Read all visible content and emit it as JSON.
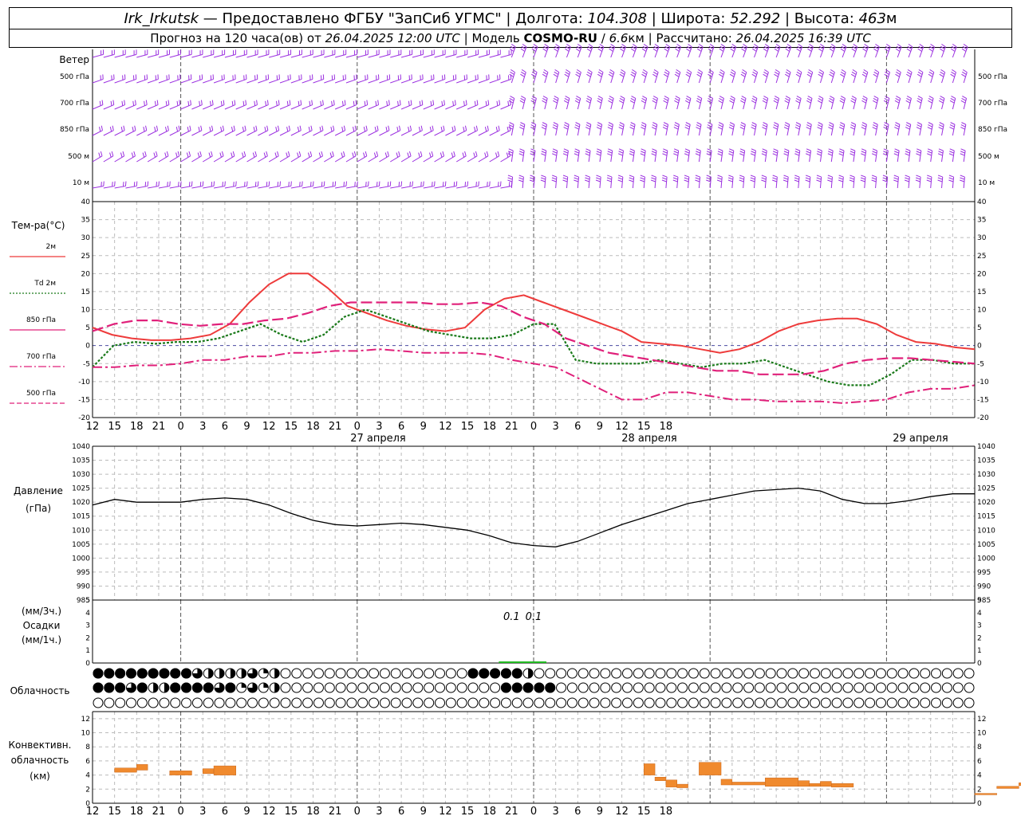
{
  "header": {
    "station": "Irk_Irkutsk",
    "dash": "—",
    "provider": "Предоставлено ФГБУ \"ЗапСиб УГМС\"",
    "lon_label": "Долгота:",
    "lon_value": "104.308",
    "lat_label": "Широта:",
    "lat_value": "52.292",
    "alt_label": "Высота:",
    "alt_value": "463",
    "alt_unit": "м",
    "forecast_prefix": "Прогноз на 120 часа(ов) от",
    "forecast_start": "26.04.2025 12:00 UTC",
    "model_label": "Модель",
    "model_name": "COSMO-RU",
    "model_res": "6.6",
    "model_res_unit": "км",
    "calc_label": "Рассчитано:",
    "calc_time": "26.04.2025 16:39 UTC"
  },
  "wind": {
    "title": "Ветер",
    "levels": [
      "500 гПа",
      "700 гПа",
      "850 гПа",
      "500 м",
      "10  м"
    ],
    "color": "#9b30e0"
  },
  "temperature": {
    "title": "Тем-ра(°C)",
    "legend": [
      {
        "label": "2м",
        "color": "#ee3b3b",
        "style": "solid"
      },
      {
        "label": "Td 2м",
        "color": "#1a7a1a",
        "style": "dotted"
      },
      {
        "label": "850 гПа",
        "color": "#e0207a",
        "style": "solid"
      },
      {
        "label": "700 гПа",
        "color": "#e0207a",
        "style": "dashdot"
      },
      {
        "label": "500 гПа",
        "color": "#e0207a",
        "style": "dash"
      }
    ],
    "yticks": [
      "40",
      "35",
      "30",
      "25",
      "20",
      "15",
      "10",
      "5",
      "0",
      "-5",
      "-10",
      "-15",
      "-20"
    ]
  },
  "x_axis": {
    "hour_labels": [
      "12",
      "15",
      "18",
      "21",
      "0",
      "3",
      "6",
      "9",
      "12",
      "15",
      "18",
      "21",
      "0",
      "3",
      "6",
      "9",
      "12",
      "15",
      "18",
      "21",
      "0",
      "3",
      "6",
      "9",
      "12",
      "15",
      "18"
    ],
    "date_labels": [
      "27 апреля",
      "28 апреля",
      "29 апреля"
    ]
  },
  "pressure": {
    "title_line1": "Давление",
    "title_line2": "(гПа)",
    "yticks": [
      "1040",
      "1035",
      "1030",
      "1025",
      "1020",
      "1015",
      "1010",
      "1005",
      "1000",
      "995",
      "990",
      "985"
    ]
  },
  "precip": {
    "unit_3h": "(мм/3ч.)",
    "title": "Осадки",
    "unit_1h": "(мм/1ч.)",
    "yticks": [
      "5",
      "4",
      "3",
      "2",
      "1",
      "0"
    ],
    "annotations": [
      "0.1",
      "0.1"
    ]
  },
  "cloud": {
    "title": "Облачность",
    "rows": [
      "4445444443222231200000000000000000444442000000000000000000000000000000000000000000000000000000000000000000000000000000000000000000000000",
      "4443422444434131200000000000000000000444440000000000000000000000000000000000000000000000000000000000000000000000000000000000000000000000",
      "0000000000000000000000000000000000000000000000000000000000000000000000000000000000000000000000000000000000000000000000000000000000000000"
    ]
  },
  "convective": {
    "title_line1": "Конвективн.",
    "title_line2": "облачность",
    "title_line3": "(км)",
    "yticks": [
      "12",
      "10",
      "8",
      "6",
      "4",
      "2",
      "0"
    ],
    "color": "#f08a2e"
  },
  "chart_data": {
    "type": "line",
    "x_hours": [
      0,
      3,
      6,
      9,
      12,
      15,
      18,
      21,
      24,
      27,
      30,
      33,
      36,
      39,
      42,
      45,
      48,
      51,
      54,
      57,
      60,
      63,
      66,
      69,
      72,
      75,
      78,
      81,
      84,
      87,
      90,
      93,
      96,
      99,
      102,
      105,
      108,
      111,
      114,
      117,
      120,
      123,
      126,
      129,
      132,
      135,
      138,
      141,
      144,
      147,
      150,
      153,
      156,
      159,
      162,
      165,
      168,
      171,
      174,
      177,
      180
    ],
    "x_axis_note": "hours from 26.04.2025 12:00 UTC",
    "temperature": {
      "ylim": [
        -20,
        40
      ],
      "series": [
        {
          "name": "2м",
          "values": [
            5,
            3,
            2,
            1.5,
            1.5,
            2,
            3,
            6,
            12,
            17,
            20,
            20,
            16,
            11,
            9,
            7,
            5.5,
            4.5,
            4,
            5,
            10,
            13,
            14,
            12,
            10,
            8,
            6,
            4,
            1,
            0.5,
            0,
            -1,
            -2,
            -1,
            1,
            4,
            6,
            7,
            7.5,
            7.5,
            6,
            3,
            1,
            0.5,
            -0.5,
            -1
          ]
        },
        {
          "name": "Td 2м",
          "values": [
            -6,
            0,
            1,
            0.5,
            1,
            1,
            2,
            4,
            6,
            3,
            1,
            3,
            8,
            10,
            8,
            6,
            4,
            3,
            2,
            2,
            3,
            6,
            6,
            -4,
            -5,
            -5,
            -5,
            -4,
            -5,
            -6,
            -5,
            -5,
            -4,
            -6,
            -8,
            -10,
            -11,
            -11,
            -8,
            -4,
            -4,
            -5,
            -5
          ]
        },
        {
          "name": "850 гПа",
          "values": [
            4,
            6,
            7,
            7,
            6,
            5.5,
            6,
            6,
            7,
            7.5,
            9,
            11,
            12,
            12,
            12,
            12,
            11.5,
            11.5,
            12,
            11,
            8,
            6,
            2,
            0,
            -2,
            -3,
            -4,
            -5,
            -6,
            -7,
            -7,
            -8,
            -8,
            -8,
            -7,
            -5,
            -4,
            -3.5,
            -3.5,
            -4,
            -4.5,
            -5
          ]
        },
        {
          "name": "700 гПа",
          "values": [
            -6,
            -6,
            -5.5,
            -5.5,
            -5,
            -4,
            -4,
            -3,
            -3,
            -2,
            -2,
            -1.5,
            -1.5,
            -1,
            -1.5,
            -2,
            -2,
            -2,
            -2.5,
            -4,
            -5,
            -6,
            -9,
            -12,
            -15,
            -15,
            -13,
            -13,
            -14,
            -15,
            -15,
            -15.5,
            -15.5,
            -15.5,
            -16,
            -15.5,
            -15,
            -13,
            -12,
            -12,
            -11
          ]
        }
      ]
    },
    "pressure": {
      "ylim": [
        985,
        1040
      ],
      "values": [
        1019,
        1021,
        1020,
        1020,
        1020,
        1021,
        1021.5,
        1021,
        1019,
        1016,
        1013.5,
        1012,
        1011.5,
        1012,
        1012.5,
        1012,
        1011,
        1010,
        1008,
        1005.5,
        1004.5,
        1004,
        1006,
        1009,
        1012,
        1014.5,
        1017,
        1019.5,
        1021,
        1022.5,
        1024,
        1024.5,
        1025,
        1024,
        1021,
        1019.5,
        1019.5,
        1020.5,
        1022,
        1023,
        1023
      ]
    },
    "precip": {
      "ylim": [
        0,
        5
      ],
      "values_3h_nonzero": [
        {
          "x_hour": 57,
          "value": 0.1
        },
        {
          "x_hour": 60,
          "value": 0.1
        }
      ]
    },
    "convective_km": {
      "ylim": [
        0,
        13
      ],
      "bars": [
        {
          "from": 2,
          "to": 4,
          "base": 4.4,
          "top": 5.0
        },
        {
          "from": 4,
          "to": 5,
          "base": 4.7,
          "top": 5.5
        },
        {
          "from": 7,
          "to": 9,
          "base": 4.0,
          "top": 4.6
        },
        {
          "from": 10,
          "to": 11,
          "base": 4.2,
          "top": 4.9
        },
        {
          "from": 11,
          "to": 13,
          "base": 4.0,
          "top": 5.3
        },
        {
          "from": 50,
          "to": 51,
          "base": 4.0,
          "top": 5.6
        },
        {
          "from": 51,
          "to": 52,
          "base": 3.2,
          "top": 3.7
        },
        {
          "from": 52,
          "to": 53,
          "base": 2.3,
          "top": 3.3
        },
        {
          "from": 53,
          "to": 54,
          "base": 2.2,
          "top": 2.7
        },
        {
          "from": 55,
          "to": 57,
          "base": 4.0,
          "top": 5.8
        },
        {
          "from": 57,
          "to": 58,
          "base": 2.6,
          "top": 3.4
        },
        {
          "from": 58,
          "to": 61,
          "base": 2.6,
          "top": 3.0
        },
        {
          "from": 61,
          "to": 64,
          "base": 2.4,
          "top": 3.6
        },
        {
          "from": 64,
          "to": 65,
          "base": 2.4,
          "top": 3.2
        },
        {
          "from": 65,
          "to": 66,
          "base": 2.4,
          "top": 2.8
        },
        {
          "from": 66,
          "to": 67,
          "base": 2.4,
          "top": 3.1
        },
        {
          "from": 67,
          "to": 69,
          "base": 2.3,
          "top": 2.8
        },
        {
          "from": 80,
          "to": 82,
          "base": 1.2,
          "top": 1.4
        },
        {
          "from": 82,
          "to": 84,
          "base": 2.1,
          "top": 2.4
        },
        {
          "from": 84,
          "to": 86,
          "base": 2.5,
          "top": 2.9
        },
        {
          "from": 86,
          "to": 88,
          "base": 2.6,
          "top": 3.3
        }
      ]
    }
  }
}
